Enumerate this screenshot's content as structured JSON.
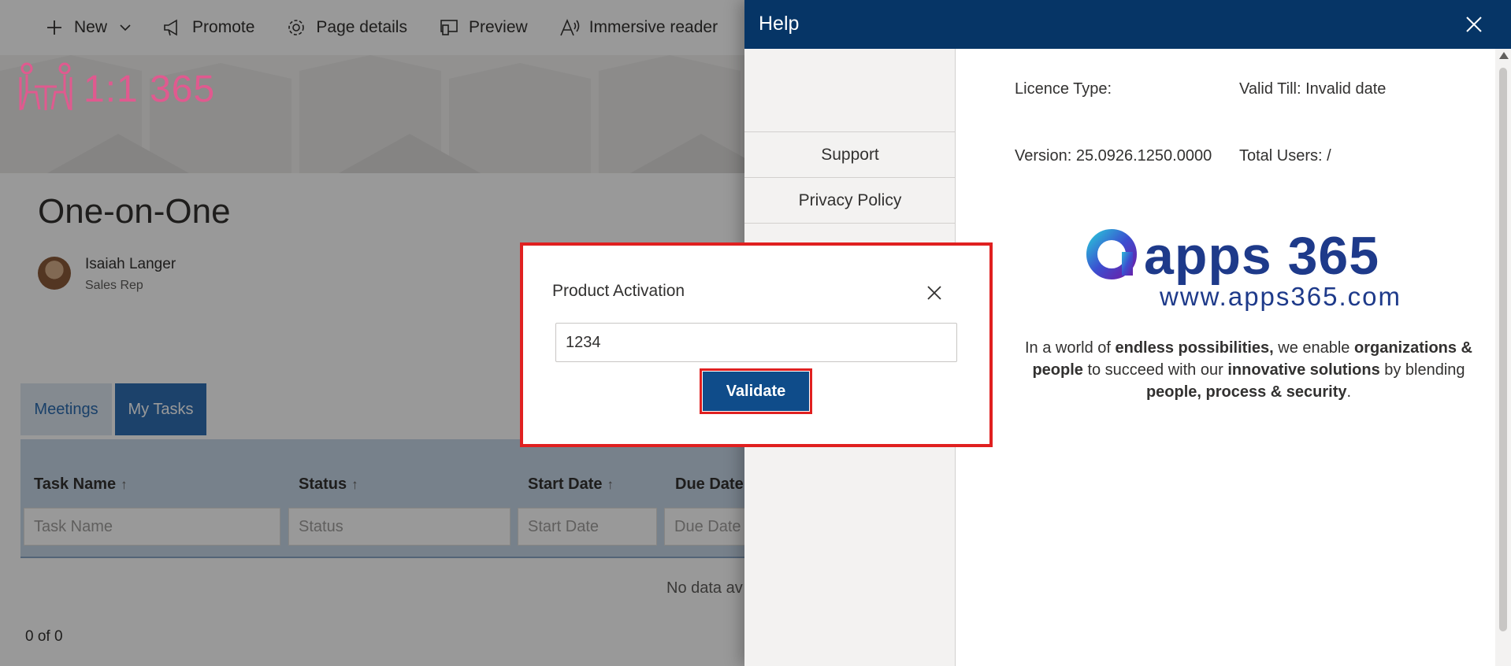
{
  "command_bar": {
    "items": [
      {
        "label": "New",
        "icon": "plus-icon"
      },
      {
        "label": "Promote",
        "icon": "megaphone-icon"
      },
      {
        "label": "Page details",
        "icon": "gear-icon"
      },
      {
        "label": "Preview",
        "icon": "preview-icon"
      },
      {
        "label": "Immersive reader",
        "icon": "immersive-reader-icon"
      }
    ]
  },
  "page": {
    "title": "One-on-One",
    "author": {
      "name": "Isaiah Langer",
      "role": "Sales Rep"
    },
    "tabs": [
      "Meetings",
      "My Tasks"
    ],
    "active_tab": "My Tasks",
    "grid": {
      "columns": [
        "Task Name",
        "Status",
        "Start Date",
        "Due Date"
      ],
      "filter_placeholders": [
        "Task Name",
        "Status",
        "Start Date",
        "Due Date"
      ],
      "empty_text": "No data av",
      "pager": "0 of 0"
    }
  },
  "help_panel": {
    "title": "Help",
    "brand": "1:1 365",
    "nav": [
      "Support",
      "Privacy Policy"
    ],
    "licence_type_label": "Licence Type:",
    "valid_till": "Valid Till: Invalid date",
    "version": "Version: 25.0926.1250.0000",
    "total_users": "Total Users: /",
    "logo_word": "apps 365",
    "logo_url": "www.apps365.com",
    "tagline": {
      "p1": "In a world of ",
      "b1": "endless possibilities,",
      "p2": " we enable ",
      "b2": "organizations & people",
      "p3": " to succeed with our ",
      "b3": "innovative solutions",
      "p4": " by blending ",
      "b4": "people, process & security",
      "p5": "."
    }
  },
  "dialog": {
    "title": "Product Activation",
    "input_value": "1234",
    "validate_label": "Validate"
  },
  "colors": {
    "help_header": "#063566",
    "accent_pink": "#e05a8f",
    "validate_button": "#0f4c8a",
    "highlight_border": "#e02020",
    "tasks_tab": "#2f6fb3"
  }
}
